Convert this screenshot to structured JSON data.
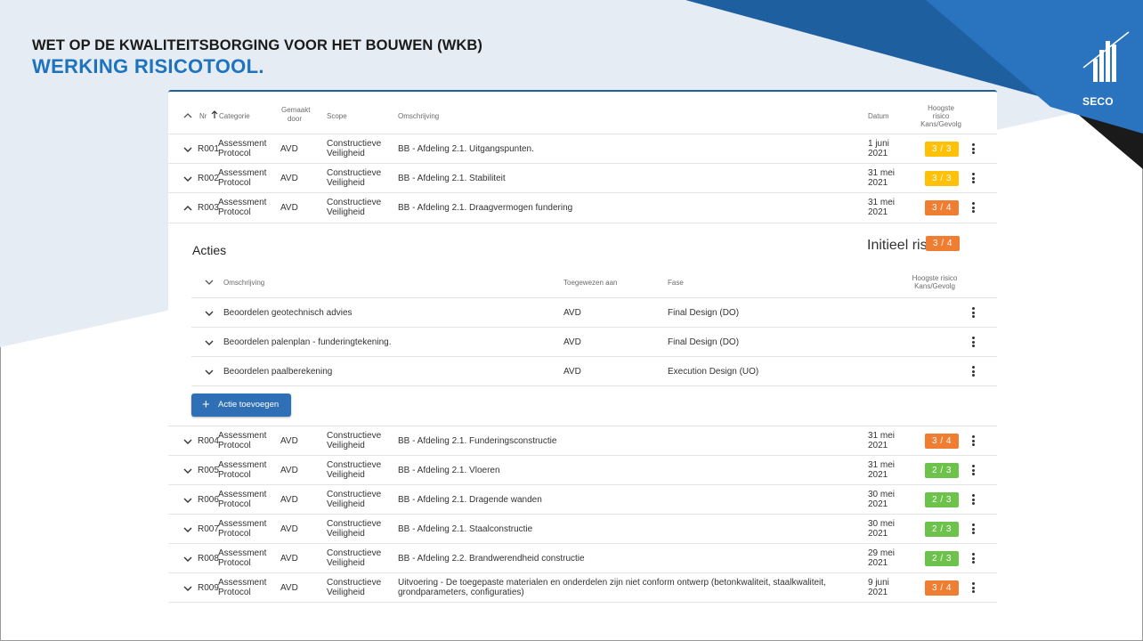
{
  "slide": {
    "title": "WET OP DE KWALITEITSBORGING VOOR HET BOUWEN (WKB)",
    "subtitle": "WERKING RISICOTOOL.",
    "logo_text": "SECO"
  },
  "colors": {
    "accent_blue": "#1e73be",
    "risk_yellow": "#ffc107",
    "risk_orange": "#ef7d32",
    "risk_green": "#6cc24a",
    "button_blue": "#2e6fb5"
  },
  "table": {
    "headers": {
      "nr": "Nr",
      "categorie": "Categorie",
      "gemaakt_door_1": "Gemaakt",
      "gemaakt_door_2": "door",
      "scope": "Scope",
      "omschrijving": "Omschrijving",
      "datum": "Datum",
      "risico_1": "Hoogste",
      "risico_2": "risico",
      "risico_3": "Kans/Gevolg"
    },
    "rows": [
      {
        "nr": "R001",
        "cat1": "Assessment",
        "cat2": "Protocol",
        "door": "AVD",
        "scope1": "Constructieve",
        "scope2": "Veiligheid",
        "omschrijving1": "BB - Afdeling 2.1. Uitgangspunten.",
        "omschrijving2": "",
        "datum1": "1 juni",
        "datum2": "2021",
        "risk": "3 / 3",
        "level": "yellow"
      },
      {
        "nr": "R002",
        "cat1": "Assessment",
        "cat2": "Protocol",
        "door": "AVD",
        "scope1": "Constructieve",
        "scope2": "Veiligheid",
        "omschrijving1": "BB - Afdeling 2.1. Stabiliteit",
        "omschrijving2": "",
        "datum1": "31 mei",
        "datum2": "2021",
        "risk": "3 / 3",
        "level": "yellow"
      },
      {
        "nr": "R003",
        "cat1": "Assessment",
        "cat2": "Protocol",
        "door": "AVD",
        "scope1": "Constructieve",
        "scope2": "Veiligheid",
        "omschrijving1": "BB - Afdeling 2.1. Draagvermogen fundering",
        "omschrijving2": "",
        "datum1": "31 mei",
        "datum2": "2021",
        "risk": "3 / 4",
        "level": "orange"
      },
      {
        "nr": "R004",
        "cat1": "Assessment",
        "cat2": "Protocol",
        "door": "AVD",
        "scope1": "Constructieve",
        "scope2": "Veiligheid",
        "omschrijving1": "BB - Afdeling 2.1. Funderingsconstructie",
        "omschrijving2": "",
        "datum1": "31 mei",
        "datum2": "2021",
        "risk": "3 / 4",
        "level": "orange"
      },
      {
        "nr": "R005",
        "cat1": "Assessment",
        "cat2": "Protocol",
        "door": "AVD",
        "scope1": "Constructieve",
        "scope2": "Veiligheid",
        "omschrijving1": "BB - Afdeling 2.1. Vloeren",
        "omschrijving2": "",
        "datum1": "31 mei",
        "datum2": "2021",
        "risk": "2 / 3",
        "level": "green"
      },
      {
        "nr": "R006",
        "cat1": "Assessment",
        "cat2": "Protocol",
        "door": "AVD",
        "scope1": "Constructieve",
        "scope2": "Veiligheid",
        "omschrijving1": "BB - Afdeling 2.1. Dragende wanden",
        "omschrijving2": "",
        "datum1": "30 mei",
        "datum2": "2021",
        "risk": "2 / 3",
        "level": "green"
      },
      {
        "nr": "R007",
        "cat1": "Assessment",
        "cat2": "Protocol",
        "door": "AVD",
        "scope1": "Constructieve",
        "scope2": "Veiligheid",
        "omschrijving1": "BB - Afdeling 2.1. Staalconstructie",
        "omschrijving2": "",
        "datum1": "30 mei",
        "datum2": "2021",
        "risk": "2 / 3",
        "level": "green"
      },
      {
        "nr": "R008",
        "cat1": "Assessment",
        "cat2": "Protocol",
        "door": "AVD",
        "scope1": "Constructieve",
        "scope2": "Veiligheid",
        "omschrijving1": "BB - Afdeling 2.2. Brandwerendheid constructie",
        "omschrijving2": "",
        "datum1": "29 mei",
        "datum2": "2021",
        "risk": "2 / 3",
        "level": "green"
      },
      {
        "nr": "R009",
        "cat1": "Assessment",
        "cat2": "Protocol",
        "door": "AVD",
        "scope1": "Constructieve",
        "scope2": "Veiligheid",
        "omschrijving1": "Uitvoering - De toegepaste materialen en onderdelen zijn niet conform ontwerp (betonkwaliteit, staalkwaliteit,",
        "omschrijving2": "grondparameters, configuraties)",
        "datum1": "9 juni",
        "datum2": "2021",
        "risk": "3 / 4",
        "level": "orange"
      }
    ]
  },
  "acties": {
    "title": "Acties",
    "initieel_label": "Initieel risico",
    "initieel_value": "3 / 4",
    "headers": {
      "omschrijving": "Omschrijving",
      "toegewezen": "Toegewezen aan",
      "fase": "Fase",
      "risico_1": "Hoogste risico",
      "risico_2": "Kans/Gevolg"
    },
    "items": [
      {
        "omschrijving": "Beoordelen geotechnisch advies",
        "toegewezen": "AVD",
        "fase": "Final Design (DO)"
      },
      {
        "omschrijving": "Beoordelen palenplan - funderingtekening.",
        "toegewezen": "AVD",
        "fase": "Final Design (DO)"
      },
      {
        "omschrijving": "Beoordelen paalberekening",
        "toegewezen": "AVD",
        "fase": "Execution Design (UO)"
      }
    ],
    "add_button": "Actie toevoegen"
  }
}
